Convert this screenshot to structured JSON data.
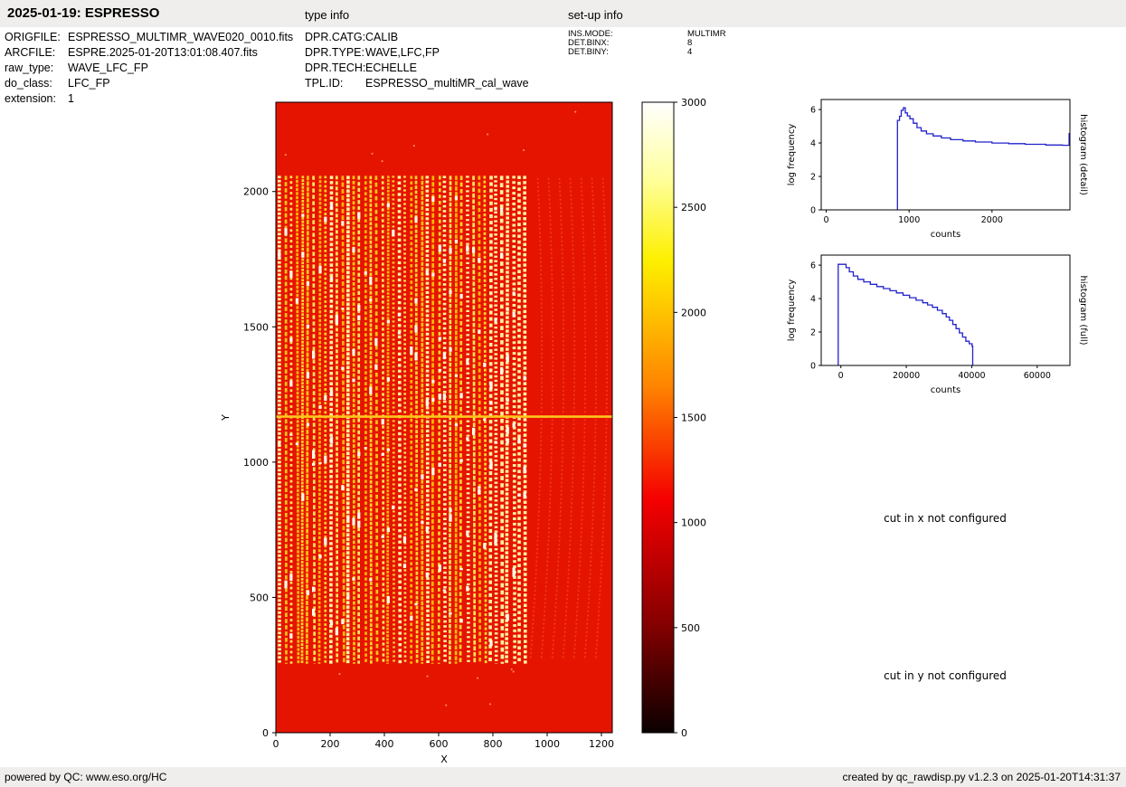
{
  "header": {
    "title": "2025-01-19: ESPRESSO",
    "type_info_label": "type info",
    "setup_info_label": "set-up info"
  },
  "metadata": {
    "left": [
      {
        "label": "ORIGFILE:",
        "value": "ESPRESSO_MULTIMR_WAVE020_0010.fits"
      },
      {
        "label": "ARCFILE:",
        "value": "ESPRE.2025-01-20T13:01:08.407.fits"
      },
      {
        "label": "raw_type:",
        "value": "WAVE_LFC_FP"
      },
      {
        "label": "do_class:",
        "value": "LFC_FP"
      },
      {
        "label": "extension:",
        "value": "1"
      }
    ],
    "type_info": [
      {
        "label": "DPR.CATG:",
        "value": "CALIB"
      },
      {
        "label": "DPR.TYPE:",
        "value": "WAVE,LFC,FP"
      },
      {
        "label": "DPR.TECH:",
        "value": "ECHELLE"
      },
      {
        "label": "TPL.ID:",
        "value": "ESPRESSO_multiMR_cal_wave"
      }
    ],
    "setup_info": [
      {
        "label": "INS.MODE:",
        "value": "MULTIMR"
      },
      {
        "label": "DET.BINX:",
        "value": "8"
      },
      {
        "label": "DET.BINY:",
        "value": "4"
      }
    ]
  },
  "messages": {
    "cut_x": "cut in x not configured",
    "cut_y": "cut in y not configured"
  },
  "footer": {
    "left": "powered by QC: www.eso.org/HC",
    "right": "created by qc_rawdisp.py v1.2.3 on 2025-01-20T14:31:37"
  },
  "chart_data": [
    {
      "id": "raw-image",
      "type": "heatmap",
      "title": "",
      "xlabel": "X",
      "ylabel": "Y",
      "xlim": [
        0,
        1240
      ],
      "ylim": [
        0,
        2330
      ],
      "xticks": [
        0,
        200,
        400,
        600,
        800,
        1000,
        1200
      ],
      "yticks": [
        0,
        500,
        1000,
        1500,
        2000
      ],
      "colormap": "hot",
      "background_level": 1150,
      "colorbar": {
        "min": 0,
        "max": 3000,
        "ticks": [
          0,
          500,
          1000,
          1500,
          2000,
          2500,
          3000
        ]
      },
      "description": "Raw echelle LFC/FP calibration frame: ~44 vertical emission-line order stripes between x=0-950 and y=250-2060 on a red background, brighter saturated band near x=780-920, faint curved orders for x>950, bright horizontal line at y=1170, plain red margins top and bottom"
    },
    {
      "id": "histogram-detail",
      "type": "line",
      "right_label": "histogram (detail)",
      "xlabel": "counts",
      "ylabel": "log frequency",
      "xlim": [
        -60,
        2940
      ],
      "ylim": [
        0,
        6.6
      ],
      "xticks": [
        0,
        1000,
        2000
      ],
      "yticks": [
        0,
        2,
        4,
        6
      ],
      "line_color": "#2222cc",
      "points": [
        [
          860,
          0
        ],
        [
          860,
          5.35
        ],
        [
          885,
          5.6
        ],
        [
          905,
          5.95
        ],
        [
          930,
          6.1
        ],
        [
          955,
          5.8
        ],
        [
          980,
          5.62
        ],
        [
          1010,
          5.45
        ],
        [
          1050,
          5.18
        ],
        [
          1095,
          4.92
        ],
        [
          1145,
          4.72
        ],
        [
          1210,
          4.55
        ],
        [
          1290,
          4.42
        ],
        [
          1390,
          4.3
        ],
        [
          1500,
          4.2
        ],
        [
          1650,
          4.12
        ],
        [
          1800,
          4.06
        ],
        [
          2000,
          4.0
        ],
        [
          2200,
          3.96
        ],
        [
          2400,
          3.92
        ],
        [
          2650,
          3.88
        ],
        [
          2850,
          3.86
        ],
        [
          2930,
          3.86
        ],
        [
          2930,
          4.6
        ]
      ]
    },
    {
      "id": "histogram-full",
      "type": "line",
      "right_label": "histogram (full)",
      "xlabel": "counts",
      "ylabel": "log frequency",
      "xlim": [
        -6000,
        70000
      ],
      "ylim": [
        0,
        6.6
      ],
      "xticks": [
        0,
        20000,
        40000,
        60000
      ],
      "yticks": [
        0,
        2,
        4,
        6
      ],
      "line_color": "#2222cc",
      "points": [
        [
          -800,
          0
        ],
        [
          -800,
          6.05
        ],
        [
          600,
          6.05
        ],
        [
          1600,
          5.85
        ],
        [
          2600,
          5.6
        ],
        [
          3800,
          5.35
        ],
        [
          5200,
          5.15
        ],
        [
          7000,
          5.0
        ],
        [
          9000,
          4.85
        ],
        [
          11000,
          4.72
        ],
        [
          13000,
          4.6
        ],
        [
          15000,
          4.47
        ],
        [
          17000,
          4.34
        ],
        [
          19000,
          4.2
        ],
        [
          21000,
          4.05
        ],
        [
          23000,
          3.9
        ],
        [
          25000,
          3.75
        ],
        [
          26500,
          3.62
        ],
        [
          28000,
          3.48
        ],
        [
          29500,
          3.3
        ],
        [
          31000,
          3.1
        ],
        [
          32200,
          2.9
        ],
        [
          33200,
          2.7
        ],
        [
          34200,
          2.45
        ],
        [
          35200,
          2.2
        ],
        [
          36200,
          1.95
        ],
        [
          37200,
          1.7
        ],
        [
          38200,
          1.45
        ],
        [
          39200,
          1.3
        ],
        [
          40100,
          1.15
        ],
        [
          40300,
          0
        ]
      ]
    }
  ]
}
